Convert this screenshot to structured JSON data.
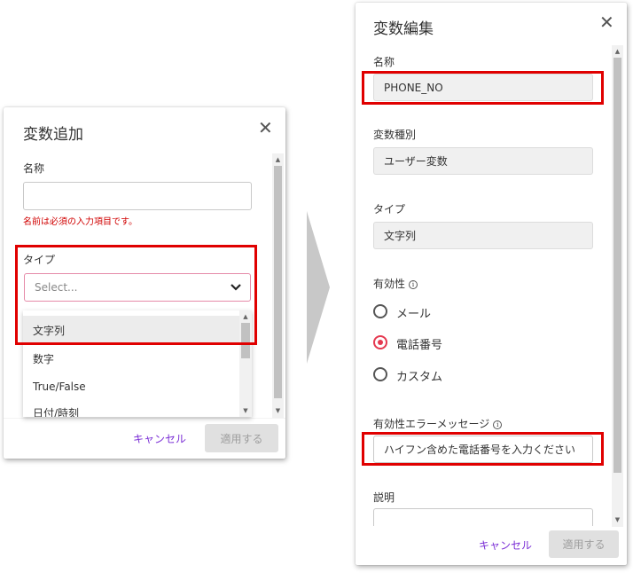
{
  "left_dialog": {
    "title": "変数追加",
    "name_label": "名称",
    "name_value": "",
    "name_error": "名前は必須の入力項目です。",
    "type_label": "タイプ",
    "type_placeholder": "Select...",
    "options": [
      "文字列",
      "数字",
      "True/False",
      "日付/時刻"
    ],
    "cancel_label": "キャンセル",
    "apply_label": "適用する"
  },
  "right_dialog": {
    "title": "変数編集",
    "name_label": "名称",
    "name_value": "PHONE_NO",
    "var_type_label": "変数種別",
    "var_type_value": "ユーザー変数",
    "type_label": "タイプ",
    "type_value": "文字列",
    "validity_label": "有効性",
    "validity_options": [
      "メール",
      "電話番号",
      "カスタム"
    ],
    "validity_selected": "電話番号",
    "error_msg_label": "有効性エラーメッセージ",
    "error_msg_value": "ハイフン含めた電話番号を入力ください",
    "description_label": "説明",
    "cancel_label": "キャンセル",
    "apply_label": "適用する"
  },
  "colors": {
    "highlight": "#e00000",
    "accent": "#7b2fd6",
    "radio_checked": "#e53950",
    "arrow": "#c8c8c8"
  },
  "icons": {
    "close": "close-icon",
    "chevron": "chevron-down-icon",
    "info": "info-icon",
    "arrow": "arrow-right-icon"
  }
}
